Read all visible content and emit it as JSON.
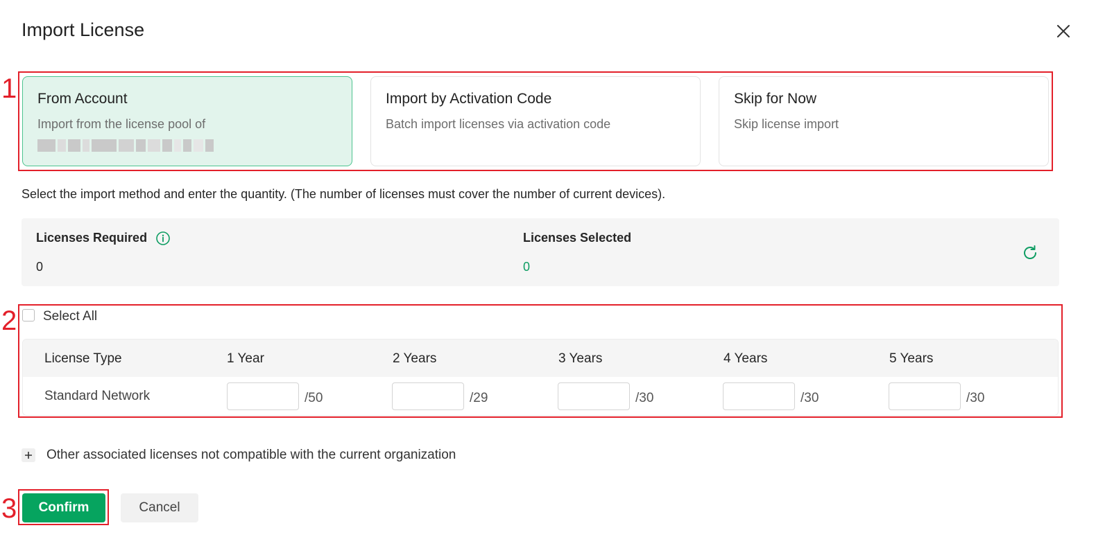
{
  "dialog": {
    "title": "Import License"
  },
  "import_methods": [
    {
      "title": "From Account",
      "description": "Import from the license pool of",
      "selected": true
    },
    {
      "title": "Import by Activation Code",
      "description": "Batch import licenses via activation code",
      "selected": false
    },
    {
      "title": "Skip for Now",
      "description": "Skip license import",
      "selected": false
    }
  ],
  "instruction": "Select the import method and enter the quantity. (The number of licenses must cover the number of current devices).",
  "summary": {
    "required_label": "Licenses Required",
    "required_value": "0",
    "selected_label": "Licenses Selected",
    "selected_value": "0"
  },
  "select_all_label": "Select All",
  "license_table": {
    "headers": [
      "License Type",
      "1 Year",
      "2 Years",
      "3 Years",
      "4 Years",
      "5 Years"
    ],
    "rows": [
      {
        "type": "Standard Network",
        "quantity_values": [
          "",
          "",
          "",
          "",
          ""
        ],
        "max": [
          "/50",
          "/29",
          "/30",
          "/30",
          "/30"
        ]
      }
    ]
  },
  "other_licenses_label": "Other associated licenses not compatible with the current organization",
  "buttons": {
    "confirm": "Confirm",
    "cancel": "Cancel"
  },
  "annotations": [
    "1",
    "2",
    "3"
  ],
  "colors": {
    "accent": "#06a45f",
    "selected_card_bg": "#e2f4ec",
    "annotation": "#e3202a"
  }
}
